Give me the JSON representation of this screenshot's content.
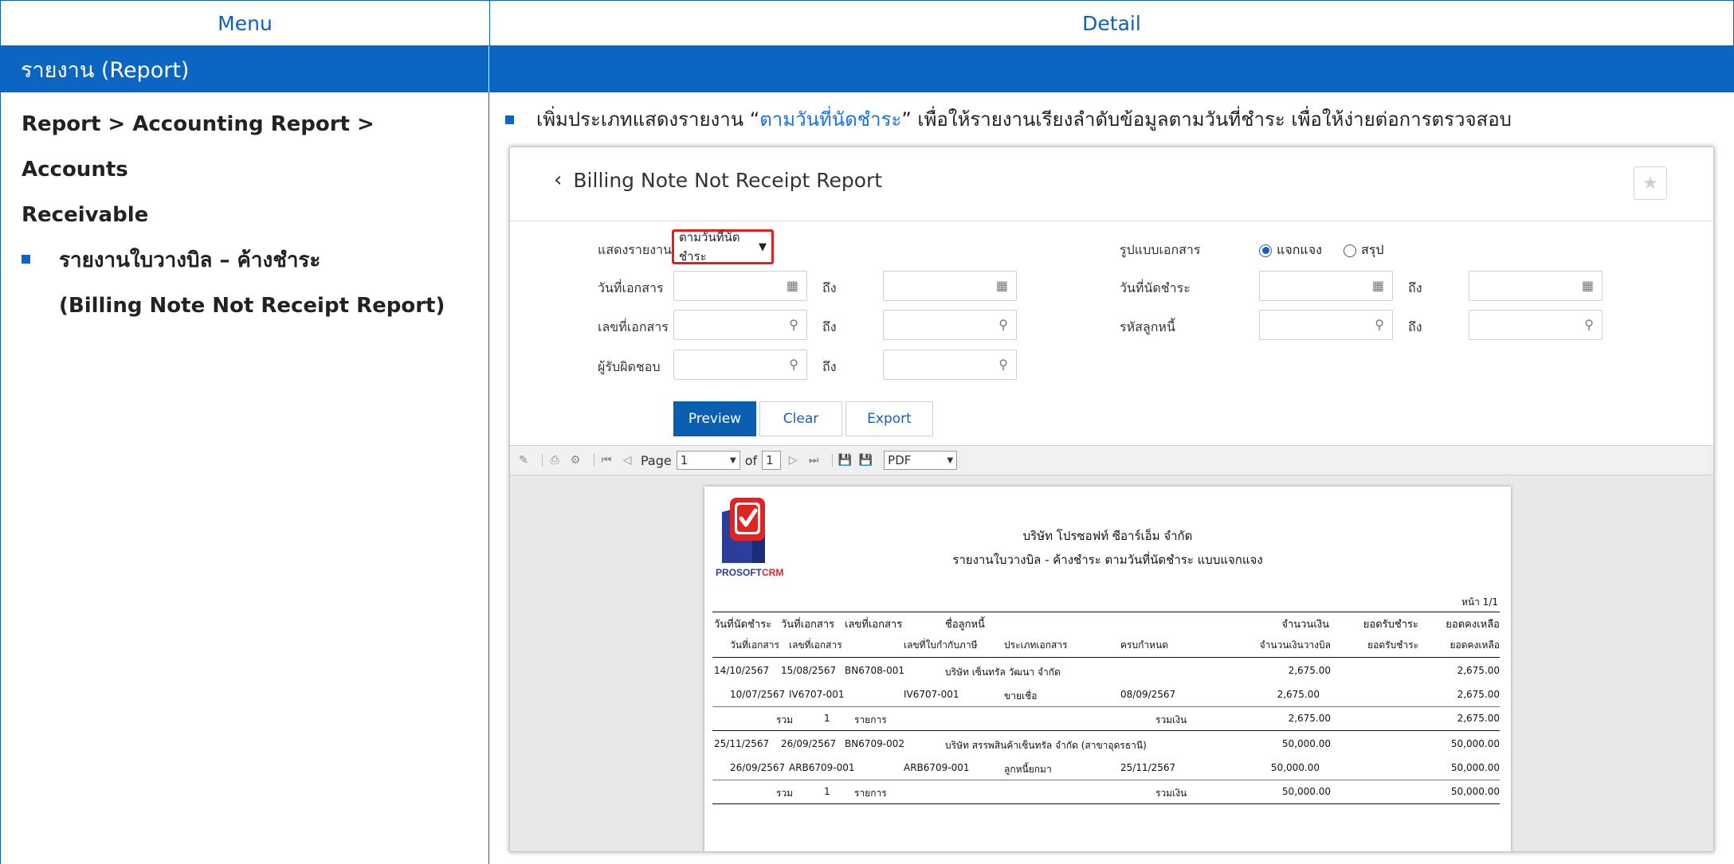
{
  "header": {
    "menu": "Menu",
    "detail": "Detail"
  },
  "section": {
    "title": "รายงาน (Report)"
  },
  "left": {
    "path_line1": "Report > Accounting Report > Accounts",
    "path_line2": "Receivable",
    "item_th": "รายงานใบวางบิล – ค้างชำระ",
    "item_en": "(Billing Note Not Receipt Report)"
  },
  "description": {
    "prefix": "เพิ่มประเภทแสดงรายงาน “",
    "highlight": "ตามวันที่นัดชำระ",
    "suffix": "” เพื่อให้รายงานเรียงลำดับข้อมูลตามวันที่ชำระ เพื่อให้ง่ายต่อการตรวจสอบ",
    "accent": "#1a73e8"
  },
  "screen": {
    "title": "Billing Note Not Receipt Report",
    "labels": {
      "show_report": "แสดงรายงาน",
      "doc_date": "วันที่เอกสาร",
      "doc_no": "เลขที่เอกสาร",
      "responsible": "ผู้รับผิดชอบ",
      "doc_format": "รูปแบบเอกสาร",
      "due_date": "วันที่นัดชำระ",
      "debtor_code": "รหัสลูกหนี้",
      "to": "ถึง"
    },
    "show_report_value": "ตามวันที่นัดชำระ",
    "radio": {
      "detail": "แจกแจง",
      "summary": "สรุป",
      "selected": "detail"
    },
    "buttons": {
      "preview": "Preview",
      "clear": "Clear",
      "export": "Export"
    },
    "toolbar": {
      "page_label": "Page",
      "page_value": "1",
      "of_label": "of",
      "total_pages": "1",
      "format": "PDF"
    }
  },
  "report": {
    "company": "บริษัท โปรซอฟท์ ซีอาร์เอ็ม จำกัด",
    "title": "รายงานใบวางบิล - ค้างชำระ ตามวันที่นัดชำระ แบบแจกแจง",
    "logo_text_a": "PROSOFT",
    "logo_text_b": "CRM",
    "page": "หน้า 1/1",
    "head1": [
      "วันที่นัดชำระ",
      "วันที่เอกสาร",
      "เลขที่เอกสาร",
      "ชื่อลูกหนี้",
      "จำนวนเงิน",
      "ยอดรับชำระ",
      "ยอดคงเหลือ"
    ],
    "head2": [
      "วันที่เอกสาร",
      "เลขที่เอกสาร",
      "เลขที่ใบกำกับภาษี",
      "ประเภทเอกสาร",
      "ครบกำหนด",
      "จำนวนเงินวางบิล",
      "ยอดรับชำระ",
      "ยอดคงเหลือ"
    ],
    "groups": [
      {
        "due": "14/10/2567",
        "doc_date": "15/08/2567",
        "doc_no": "BN6708-001",
        "customer": "บริษัท เซ็นทรัล วัฒนา จำกัด",
        "amount": "2,675.00",
        "balance": "2,675.00",
        "line": {
          "doc_date": "10/07/2567",
          "doc_no": "IV6707-001",
          "tax_no": "IV6707-001",
          "type": "ขายเชื่อ",
          "due": "08/09/2567",
          "amount": "2,675.00",
          "balance": "2,675.00"
        },
        "total": {
          "label": "รวม",
          "count": "1",
          "unit": "รายการ",
          "sum_label": "รวมเงิน",
          "amount": "2,675.00",
          "balance": "2,675.00"
        }
      },
      {
        "due": "25/11/2567",
        "doc_date": "26/09/2567",
        "doc_no": "BN6709-002",
        "customer": "บริษัท สรรพสินค้าเซ็นทรัล จำกัด (สาขาอุดรธานี)",
        "amount": "50,000.00",
        "balance": "50,000.00",
        "line": {
          "doc_date": "26/09/2567",
          "doc_no": "ARB6709-001",
          "tax_no": "ARB6709-001",
          "type": "ลูกหนี้ยกมา",
          "due": "25/11/2567",
          "amount": "50,000.00",
          "balance": "50,000.00"
        },
        "total": {
          "label": "รวม",
          "count": "1",
          "unit": "รายการ",
          "sum_label": "รวมเงิน",
          "amount": "50,000.00",
          "balance": "50,000.00"
        }
      }
    ]
  }
}
